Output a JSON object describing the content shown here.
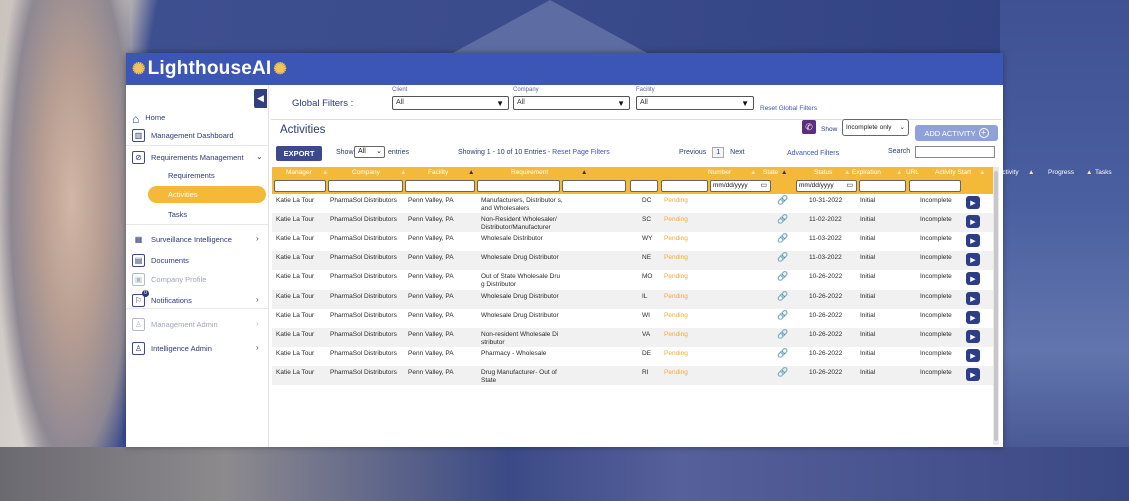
{
  "brand": {
    "name": "LighthouseAI"
  },
  "sidebar": {
    "items": [
      {
        "label": "Home",
        "icon": "home-icon"
      },
      {
        "label": "Management Dashboard",
        "icon": "chart-icon"
      },
      {
        "label": "Requirements Management",
        "icon": "check-circle-icon"
      },
      {
        "label": "Surveillance Intelligence",
        "icon": "grid-icon"
      },
      {
        "label": "Documents",
        "icon": "document-icon"
      },
      {
        "label": "Company Profile",
        "icon": "company-icon"
      },
      {
        "label": "Notifications",
        "icon": "bell-icon",
        "badge": "0"
      },
      {
        "label": "Management Admin",
        "icon": "admin-icon"
      },
      {
        "label": "Intelligence Admin",
        "icon": "admin-icon"
      }
    ],
    "sub_items": [
      "Requirements",
      "Activities",
      "Tasks"
    ]
  },
  "global_filters": {
    "label": "Global Filters :",
    "client": {
      "caption": "Client",
      "value": "All"
    },
    "company": {
      "caption": "Company",
      "value": "All"
    },
    "facility": {
      "caption": "Facility",
      "value": "All"
    },
    "reset": "Reset Global Filters"
  },
  "page": {
    "title": "Activities",
    "show_label": "Show",
    "show_value": "Incomplete only",
    "add_button": "ADD ACTIVITY"
  },
  "toolbar": {
    "export": "EXPORT",
    "show": "Show",
    "entries_value": "All",
    "entries": "entries",
    "showing": "Showing 1 - 10 of 10 Entries - ",
    "reset_page": "Reset Page Filters",
    "previous": "Previous",
    "page": "1",
    "next": "Next",
    "advanced": "Advanced Filters",
    "search": "Search"
  },
  "table": {
    "headers": [
      "Manager",
      "Company",
      "Facility",
      "Requirement",
      "Number",
      "State",
      "Status",
      "Expiration",
      "URL",
      "Activity Start",
      "Activity",
      "Progress",
      "Tasks"
    ],
    "date_placeholder": "mm/dd/yyyy",
    "rows": [
      {
        "manager": "Katie La Tour",
        "company": "PharmaSol Distributors",
        "facility": "Penn Valley, PA",
        "requirement": "Manufacturers, Distributor s, and Wholesalers",
        "state": "DC",
        "status": "Pending",
        "start": "10-31-2022",
        "activity": "Initial",
        "progress": "Incomplete"
      },
      {
        "manager": "Katie La Tour",
        "company": "PharmaSol Distributors",
        "facility": "Penn Valley, PA",
        "requirement": "Non-Resident Wholesaler/ Distributor/Manufacturer",
        "state": "SC",
        "status": "Pending",
        "start": "11-02-2022",
        "activity": "Initial",
        "progress": "Incomplete"
      },
      {
        "manager": "Katie La Tour",
        "company": "PharmaSol Distributors",
        "facility": "Penn Valley, PA",
        "requirement": "Wholesale Distributor",
        "state": "WY",
        "status": "Pending",
        "start": "11-03-2022",
        "activity": "Initial",
        "progress": "Incomplete"
      },
      {
        "manager": "Katie La Tour",
        "company": "PharmaSol Distributors",
        "facility": "Penn Valley, PA",
        "requirement": "Wholesale Drug Distributor",
        "state": "NE",
        "status": "Pending",
        "start": "11-03-2022",
        "activity": "Initial",
        "progress": "Incomplete"
      },
      {
        "manager": "Katie La Tour",
        "company": "PharmaSol Distributors",
        "facility": "Penn Valley, PA",
        "requirement": "Out of State Wholesale Dru g Distributor",
        "state": "MO",
        "status": "Pending",
        "start": "10-26-2022",
        "activity": "Initial",
        "progress": "Incomplete"
      },
      {
        "manager": "Katie La Tour",
        "company": "PharmaSol Distributors",
        "facility": "Penn Valley, PA",
        "requirement": "Wholesale Drug Distributor",
        "state": "IL",
        "status": "Pending",
        "start": "10-26-2022",
        "activity": "Initial",
        "progress": "Incomplete"
      },
      {
        "manager": "Katie La Tour",
        "company": "PharmaSol Distributors",
        "facility": "Penn Valley, PA",
        "requirement": "Wholesale Drug Distributor",
        "state": "WI",
        "status": "Pending",
        "start": "10-26-2022",
        "activity": "Initial",
        "progress": "Incomplete"
      },
      {
        "manager": "Katie La Tour",
        "company": "PharmaSol Distributors",
        "facility": "Penn Valley, PA",
        "requirement": "Non-resident Wholesale Di stributor",
        "state": "VA",
        "status": "Pending",
        "start": "10-26-2022",
        "activity": "Initial",
        "progress": "Incomplete"
      },
      {
        "manager": "Katie La Tour",
        "company": "PharmaSol Distributors",
        "facility": "Penn Valley, PA",
        "requirement": "Pharmacy - Wholesale",
        "state": "DE",
        "status": "Pending",
        "start": "10-26-2022",
        "activity": "Initial",
        "progress": "Incomplete"
      },
      {
        "manager": "Katie La Tour",
        "company": "PharmaSol Distributors",
        "facility": "Penn Valley, PA",
        "requirement": "Drug Manufacturer- Out of State",
        "state": "RI",
        "status": "Pending",
        "start": "10-26-2022",
        "activity": "Initial",
        "progress": "Incomplete"
      }
    ]
  },
  "colors": {
    "brand": "#3c56b5",
    "accent": "#f5b93a",
    "pending": "#f5a93a"
  }
}
